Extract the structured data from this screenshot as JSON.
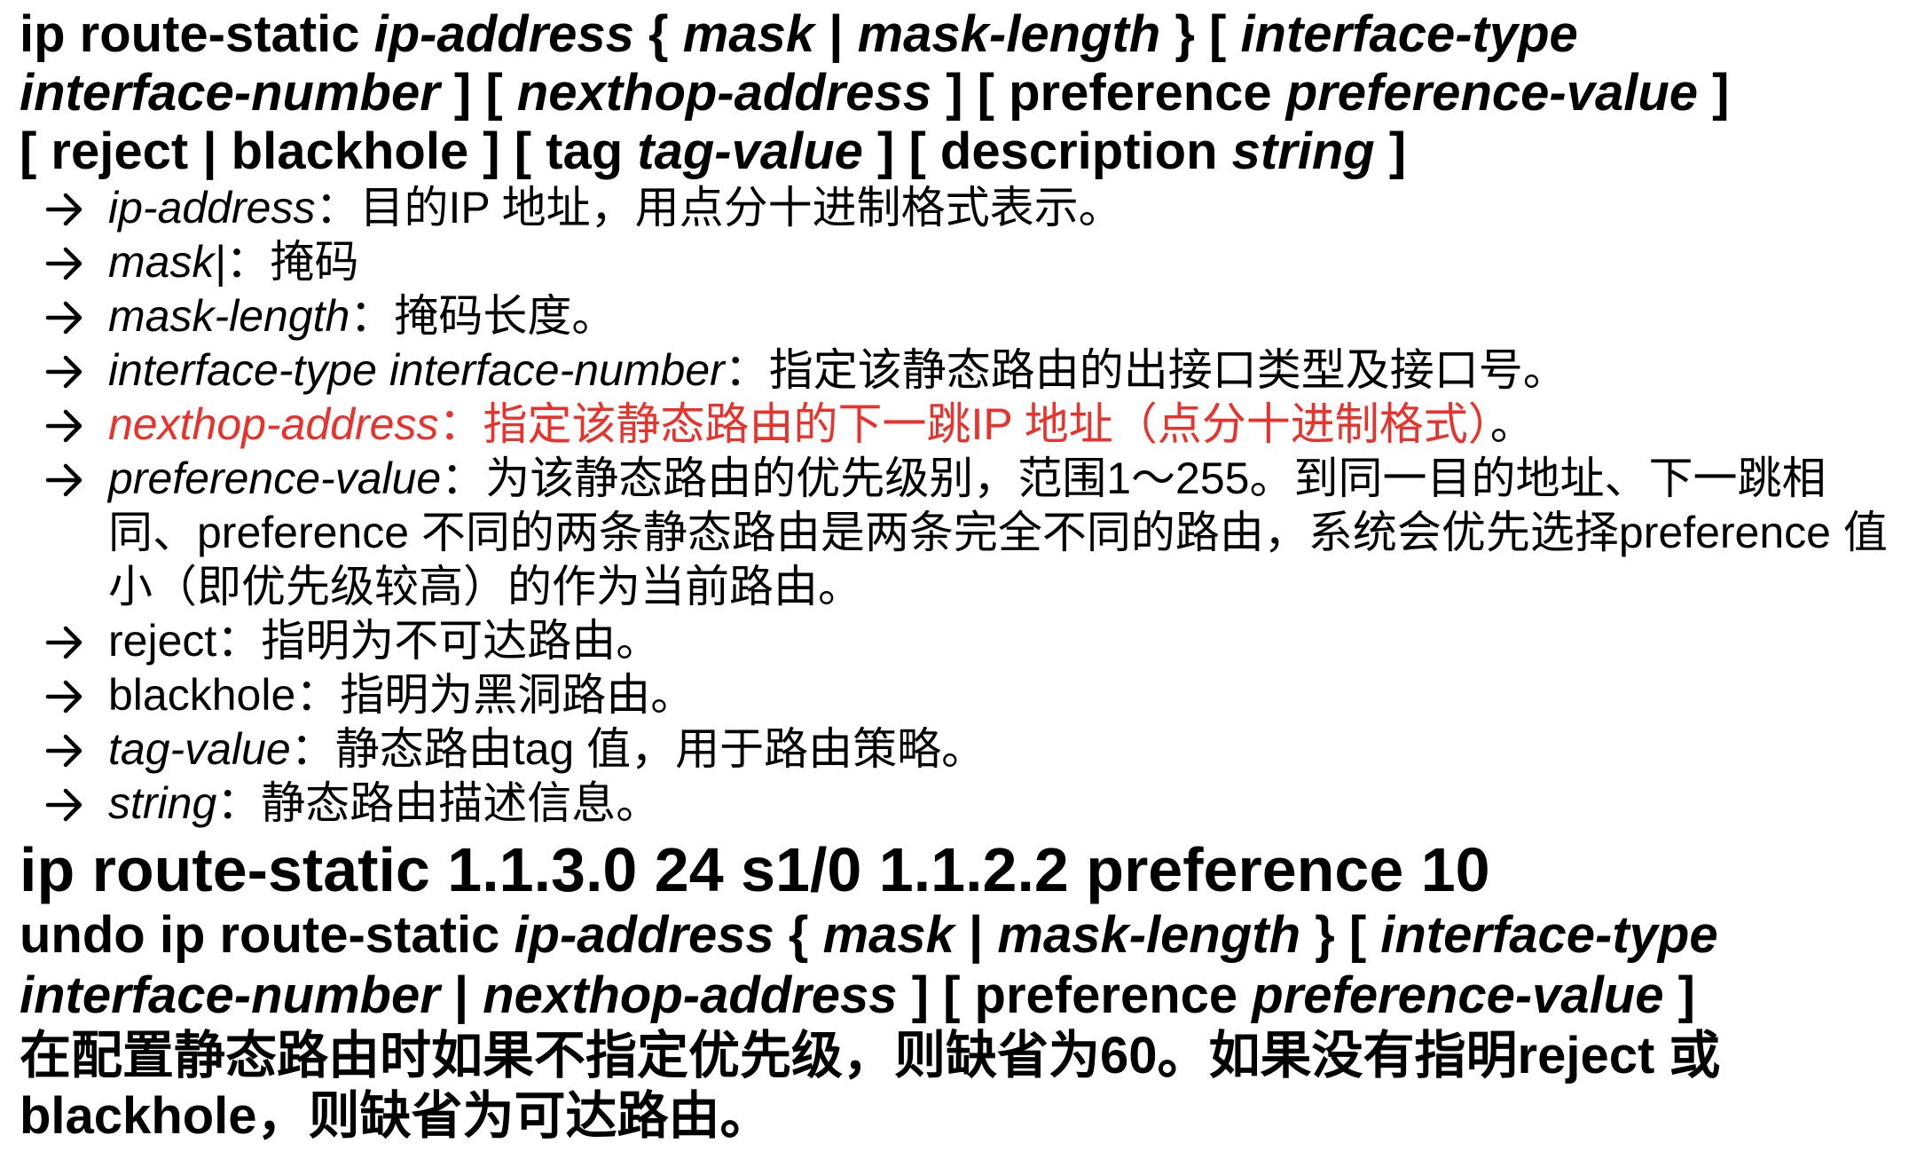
{
  "syntax": {
    "cmd": "ip route-static ",
    "ip_address": "ip-address",
    "open_brace": " { ",
    "mask": "mask",
    "pipe": " | ",
    "mask_length": "mask-length",
    "close_brace": " } [ ",
    "interface_type": "interface-type",
    "interface_number": "interface-number",
    "bracket1": " ] [ ",
    "nexthop": "nexthop-address",
    "bracket2": " ] [ preference ",
    "pref_value": "preference-value",
    "bracket3": " ]",
    "reject_part": "[ reject | blackhole ] [ tag ",
    "tag_value": "tag-value",
    "bracket4": " ] [ description ",
    "string": "string",
    "bracket5": " ]"
  },
  "params": [
    {
      "name": "ip-address",
      "sep": "：",
      "desc": "目的IP 地址，用点分十进制格式表示。"
    },
    {
      "name": "mask|",
      "sep": "：",
      "desc": "掩码"
    },
    {
      "name": "mask-length",
      "sep": "：",
      "desc": "掩码长度。"
    },
    {
      "name": "interface-type interface-number",
      "sep": "：",
      "desc": "指定该静态路由的出接口类型及接口号。"
    },
    {
      "name": "nexthop-address",
      "sep": "：",
      "desc": "指定该静态路由的下一跳IP 地址（点分十进制格式）",
      "tail": "。"
    },
    {
      "name": "preference-value",
      "sep": "：",
      "desc": "为该静态路由的优先级别，范围1～255。到同一目的地址、下一跳相同、preference 不同的两条静态路由是两条完全不同的路由，系统会优先选择preference 值小（即优先级较高）的作为当前路由。"
    },
    {
      "name": "reject",
      "sep": "：",
      "desc": "指明为不可达路由。"
    },
    {
      "name": "blackhole",
      "sep": "：",
      "desc": "指明为黑洞路由。"
    },
    {
      "name": "tag-value",
      "sep": "：",
      "desc": "静态路由tag 值，用于路由策略。"
    },
    {
      "name": "string",
      "sep": "：",
      "desc": "静态路由描述信息。"
    }
  ],
  "example": "ip route-static 1.1.3.0 24 s1/0 1.1.2.2 preference 10",
  "undo": {
    "cmd": "undo ip route-static ",
    "ip_address": "ip-address",
    "open_brace": " { ",
    "mask": "mask",
    "pipe": " | ",
    "mask_length": "mask-length",
    "close_brace": " } [ ",
    "interface_type": "interface-type",
    "interface_number": "interface-number",
    "pipe2": " | ",
    "nexthop": "nexthop-address",
    "bracket2": " ] [ preference ",
    "pref_value": "preference-value",
    "bracket3": " ]"
  },
  "note": "在配置静态路由时如果不指定优先级，则缺省为60。如果没有指明reject 或blackhole，则缺省为可达路由。",
  "colors": {
    "highlight": "#e8322b",
    "text": "#000000"
  }
}
